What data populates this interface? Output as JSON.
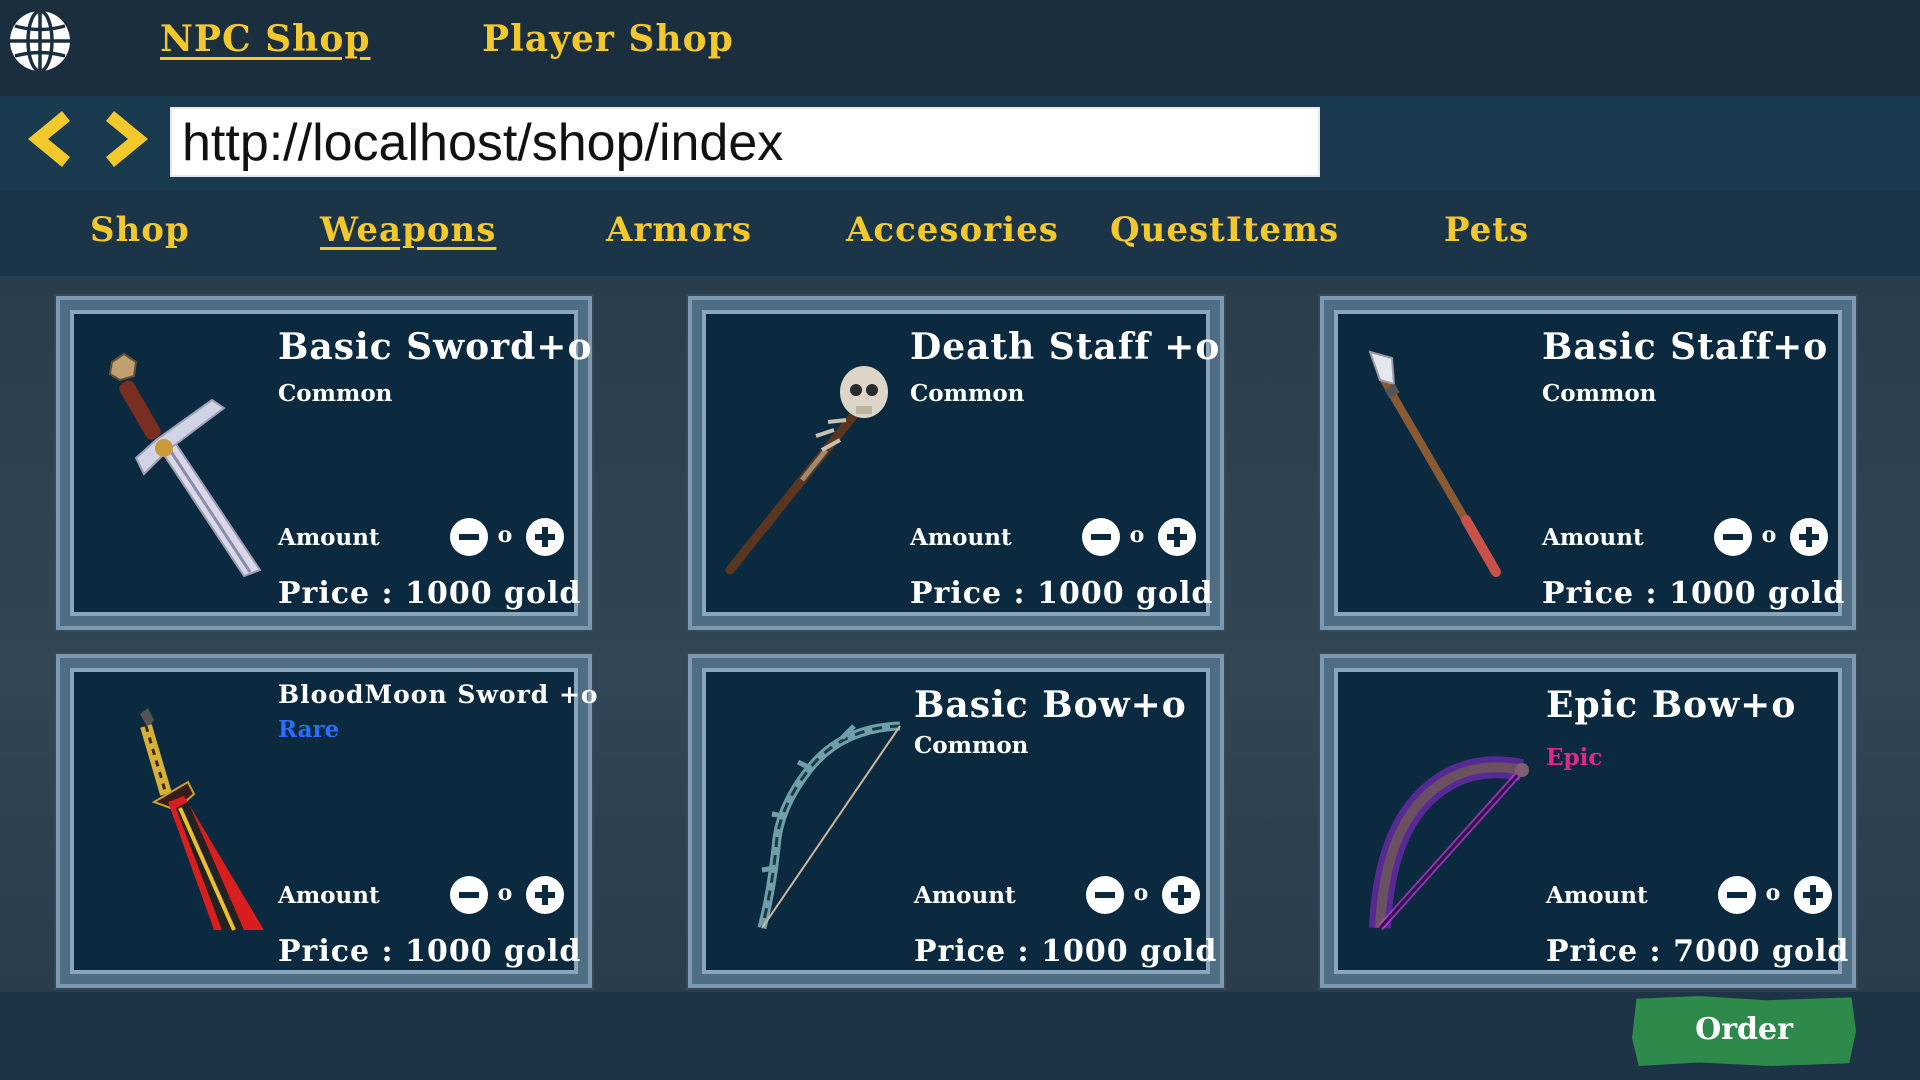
{
  "top_tabs": {
    "npc_shop": "NPC Shop",
    "player_shop": "Player Shop"
  },
  "address_bar": {
    "url": "http://localhost/shop/index"
  },
  "categories": [
    "Shop",
    "Weapons",
    "Armors",
    "Accesories",
    "QuestItems",
    "Pets"
  ],
  "active_category": "Weapons",
  "items": [
    {
      "name": "Basic Sword+o",
      "rarity": "Common",
      "rarity_color": "#ffffff",
      "amount_label": "Amount",
      "quantity": "o",
      "price": "Price : 1000 gold",
      "icon": "sword-icon"
    },
    {
      "name": "Death Staff +o",
      "rarity": "Common",
      "rarity_color": "#ffffff",
      "amount_label": "Amount",
      "quantity": "o",
      "price": "Price : 1000 gold",
      "icon": "skull-staff-icon"
    },
    {
      "name": "Basic Staff+o",
      "rarity": "Common",
      "rarity_color": "#ffffff",
      "amount_label": "Amount",
      "quantity": "o",
      "price": "Price : 1000 gold",
      "icon": "spear-staff-icon"
    },
    {
      "name": "BloodMoon Sword +o",
      "rarity": "Rare",
      "rarity_color": "#2a6cff",
      "amount_label": "Amount",
      "quantity": "o",
      "price": "Price : 1000 gold",
      "icon": "bloodmoon-sword-icon"
    },
    {
      "name": "Basic Bow+o",
      "rarity": "Common",
      "rarity_color": "#ffffff",
      "amount_label": "Amount",
      "quantity": "o",
      "price": "Price : 1000 gold",
      "icon": "bow-icon"
    },
    {
      "name": "Epic Bow+o",
      "rarity": "Epic",
      "rarity_color": "#e0288a",
      "amount_label": "Amount",
      "quantity": "o",
      "price": "Price : 7000 gold",
      "icon": "epic-bow-icon"
    }
  ],
  "order_button": {
    "label": "Order"
  },
  "colors": {
    "accent_yellow": "#f2c82a",
    "order_green": "#2e8a4b",
    "card_bg": "#0b2a3f"
  }
}
